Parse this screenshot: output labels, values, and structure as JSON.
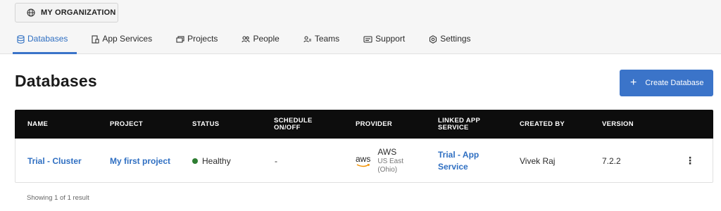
{
  "org": {
    "label": "MY ORGANIZATION",
    "icon": "globe-icon"
  },
  "tabs": [
    {
      "label": "Databases",
      "icon": "database-icon",
      "active": true
    },
    {
      "label": "App Services",
      "icon": "app-services-icon",
      "active": false
    },
    {
      "label": "Projects",
      "icon": "projects-icon",
      "active": false
    },
    {
      "label": "People",
      "icon": "people-icon",
      "active": false
    },
    {
      "label": "Teams",
      "icon": "teams-icon",
      "active": false
    },
    {
      "label": "Support",
      "icon": "support-icon",
      "active": false
    },
    {
      "label": "Settings",
      "icon": "settings-icon",
      "active": false
    }
  ],
  "page": {
    "title": "Databases"
  },
  "create_button": {
    "label": "Create Database",
    "icon": "plus-icon"
  },
  "table": {
    "columns": [
      "NAME",
      "PROJECT",
      "STATUS",
      "SCHEDULE ON/OFF",
      "PROVIDER",
      "LINKED APP SERVICE",
      "CREATED BY",
      "VERSION"
    ],
    "columns_split": [
      [
        "NAME"
      ],
      [
        "PROJECT"
      ],
      [
        "STATUS"
      ],
      [
        "SCHEDULE",
        "ON/OFF"
      ],
      [
        "PROVIDER"
      ],
      [
        "LINKED APP",
        "SERVICE"
      ],
      [
        "CREATED BY"
      ],
      [
        "VERSION"
      ]
    ],
    "rows": [
      {
        "name": "Trial - Cluster",
        "project": "My first project",
        "status": "Healthy",
        "status_color": "#2e7d32",
        "schedule": "-",
        "provider_logo": "aws",
        "provider_name": "AWS",
        "provider_region_line1": "US East",
        "provider_region_line2": "(Ohio)",
        "linked_app_service_line1": "Trial - App",
        "linked_app_service_line2": "Service",
        "created_by": "Vivek Raj",
        "version": "7.2.2",
        "menu_icon": "kebab-menu-icon"
      }
    ]
  },
  "footer": {
    "result_text": "Showing 1 of 1 result"
  },
  "colors": {
    "accent": "#3b74c9",
    "header_bg": "#0d0d0d",
    "healthy": "#2e7d32"
  }
}
